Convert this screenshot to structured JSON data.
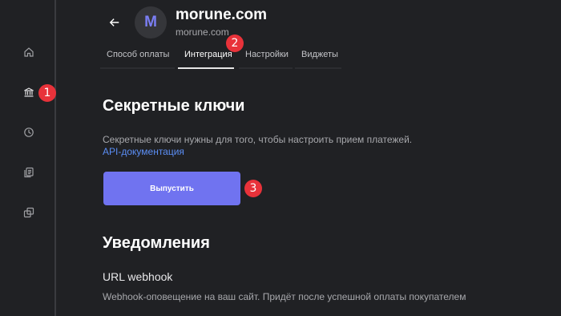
{
  "sidebar": {
    "items": [
      {
        "name": "home"
      },
      {
        "name": "bank"
      },
      {
        "name": "history"
      },
      {
        "name": "documents"
      },
      {
        "name": "copy"
      }
    ]
  },
  "header": {
    "back_icon": "arrow-left-icon",
    "avatar_letter": "M",
    "shop_title": "morune.com",
    "shop_domain": "morune.com"
  },
  "tabs": [
    {
      "label": "Способ оплаты",
      "active": false
    },
    {
      "label": "Интеграция",
      "active": true
    },
    {
      "label": "Настройки",
      "active": false
    },
    {
      "label": "Виджеты",
      "active": false
    }
  ],
  "secret_keys": {
    "title": "Секретные ключи",
    "description": "Секретные ключи нужны для того, чтобы настроить прием платежей.",
    "api_link": "API-документация",
    "issue_button": "Выпустить"
  },
  "notifications": {
    "title": "Уведомления",
    "webhook_label": "URL webhook",
    "webhook_description": "Webhook-оповещение на ваш сайт. Придёт после успешной оплаты покупателем"
  },
  "badges": [
    "1",
    "2",
    "3"
  ],
  "colors": {
    "background": "#202124",
    "accent_button": "#7073f0",
    "link": "#5b8ef5",
    "badge": "#e8323a",
    "avatar_letter": "#7b7ff5"
  }
}
